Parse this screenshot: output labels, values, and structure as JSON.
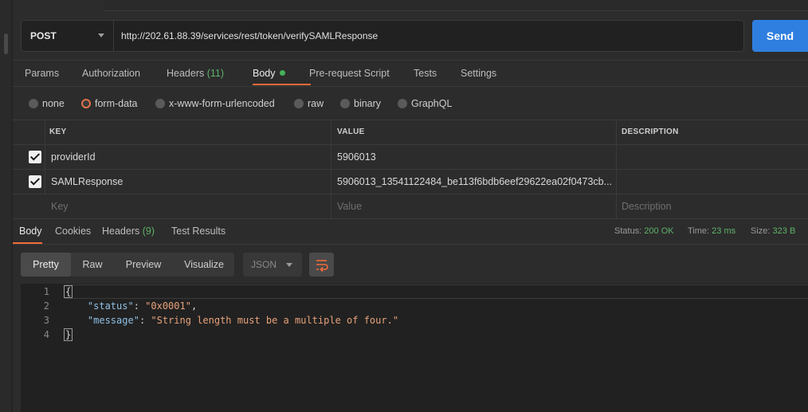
{
  "request": {
    "method": "POST",
    "url": "http://202.61.88.39/services/rest/token/verifySAMLResponse",
    "send_label": "Send"
  },
  "request_tabs": [
    {
      "label": "Params"
    },
    {
      "label": "Authorization"
    },
    {
      "label": "Headers",
      "count": "(11)"
    },
    {
      "label": "Body",
      "active": true
    },
    {
      "label": "Pre-request Script"
    },
    {
      "label": "Tests"
    },
    {
      "label": "Settings"
    }
  ],
  "body_modes": [
    {
      "label": "none"
    },
    {
      "label": "form-data",
      "selected": true
    },
    {
      "label": "x-www-form-urlencoded"
    },
    {
      "label": "raw"
    },
    {
      "label": "binary"
    },
    {
      "label": "GraphQL"
    }
  ],
  "params_table": {
    "headers": [
      "KEY",
      "VALUE",
      "DESCRIPTION"
    ],
    "rows": [
      {
        "checked": true,
        "key": "providerId",
        "value": "5906013",
        "description": ""
      },
      {
        "checked": true,
        "key": "SAMLResponse",
        "value": "5906013_13541122484_be113f6bdb6eef29622ea02f0473cb...",
        "description": ""
      }
    ],
    "placeholder": {
      "key": "Key",
      "value": "Value",
      "description": "Description"
    }
  },
  "response_tabs": [
    {
      "label": "Body",
      "active": true
    },
    {
      "label": "Cookies"
    },
    {
      "label": "Headers",
      "count": "(9)"
    },
    {
      "label": "Test Results"
    }
  ],
  "response_stats": {
    "status_label": "Status:",
    "status_value": "200 OK",
    "time_label": "Time:",
    "time_value": "23 ms",
    "size_label": "Size:",
    "size_value": "323 B"
  },
  "view_modes": [
    "Pretty",
    "Raw",
    "Preview",
    "Visualize"
  ],
  "format": "JSON",
  "code": {
    "line_numbers": [
      "1",
      "2",
      "3",
      "4"
    ],
    "open_brace": "{",
    "close_brace": "}",
    "status_key": "\"status\"",
    "status_val": "\"0x0001\"",
    "message_key": "\"message\"",
    "message_val": "\"String length must be a multiple of four.\""
  },
  "colors": {
    "accent": "#f26b3a",
    "send": "#2f7fe0",
    "ok": "#5fb36a"
  },
  "icons": [
    "chevron-down-icon",
    "checkbox-icon",
    "wrap-lines-icon"
  ]
}
